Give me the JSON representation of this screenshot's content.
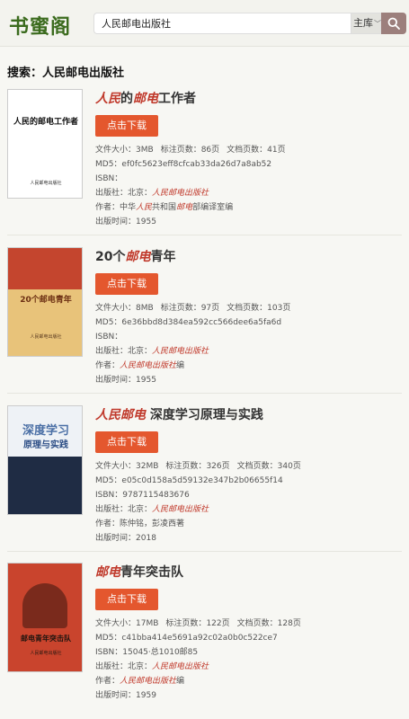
{
  "header": {
    "logo": "书蜜阁",
    "search_value": "人民邮电出版社",
    "library_select": "主库"
  },
  "search_heading": "搜索：人民邮电出版社",
  "labels": {
    "download": "点击下载",
    "file_size": "文件大小：",
    "marked_pages": "标注页数：",
    "doc_pages": "文档页数：",
    "md5": "MD5：",
    "isbn": "ISBN：",
    "publisher": "出版社：",
    "publisher_place": "北京：",
    "author": "作者：",
    "pub_time": "出版时间："
  },
  "results": [
    {
      "title_hl1": "人民",
      "title_mid": "的",
      "title_hl2": "邮电",
      "title_rest": "工作者",
      "cover_text": "人民的邮电工作者",
      "cover_sub": "人民邮电出版社",
      "size": "3MB",
      "marked_pages": "86页",
      "doc_pages": "41页",
      "md5": "ef0fc5623eff8cfcab33da26d7a8ab52",
      "isbn": "",
      "publisher": "人民邮电出版社",
      "author_a": "中华",
      "author_b": "人民",
      "author_c": "共和国",
      "author_d": "邮电",
      "author_e": "部编译室编",
      "year": "1955"
    },
    {
      "title_pre": "20个",
      "title_hl": "邮电",
      "title_rest": "青年",
      "cover_text": "20个邮电青年",
      "cover_sub": "人民邮电出版社",
      "size": "8MB",
      "marked_pages": "97页",
      "doc_pages": "103页",
      "md5": "6e36bbd8d384ea592cc566dee6a5fa6d",
      "isbn": "",
      "publisher": "人民邮电出版社",
      "author_link": "人民邮电出版社",
      "author_suffix": "编",
      "year": "1955"
    },
    {
      "title_hl": "人民邮电",
      "title_rest": " 深度学习原理与实践",
      "cover_text_1": "深度学习",
      "cover_text_2": "原理与实践",
      "size": "32MB",
      "marked_pages": "326页",
      "doc_pages": "340页",
      "md5": "e05c0d158a5d59132e347b2b06655f14",
      "isbn": "9787115483676",
      "publisher": "人民邮电出版社",
      "author": "陈仲铭，彭凌西著",
      "year": "2018"
    },
    {
      "title_hl": "邮电",
      "title_rest": "青年突击队",
      "cover_text": "邮电青年突击队",
      "cover_sub": "人民邮电出版社",
      "size": "17MB",
      "marked_pages": "122页",
      "doc_pages": "128页",
      "md5": "c41bba414e5691a92c02a0b0c522ce7",
      "isbn": "15045·总1010邮85",
      "publisher": "人民邮电出版社",
      "author_link": "人民邮电出版社",
      "author_suffix": "编",
      "year": "1959"
    }
  ]
}
